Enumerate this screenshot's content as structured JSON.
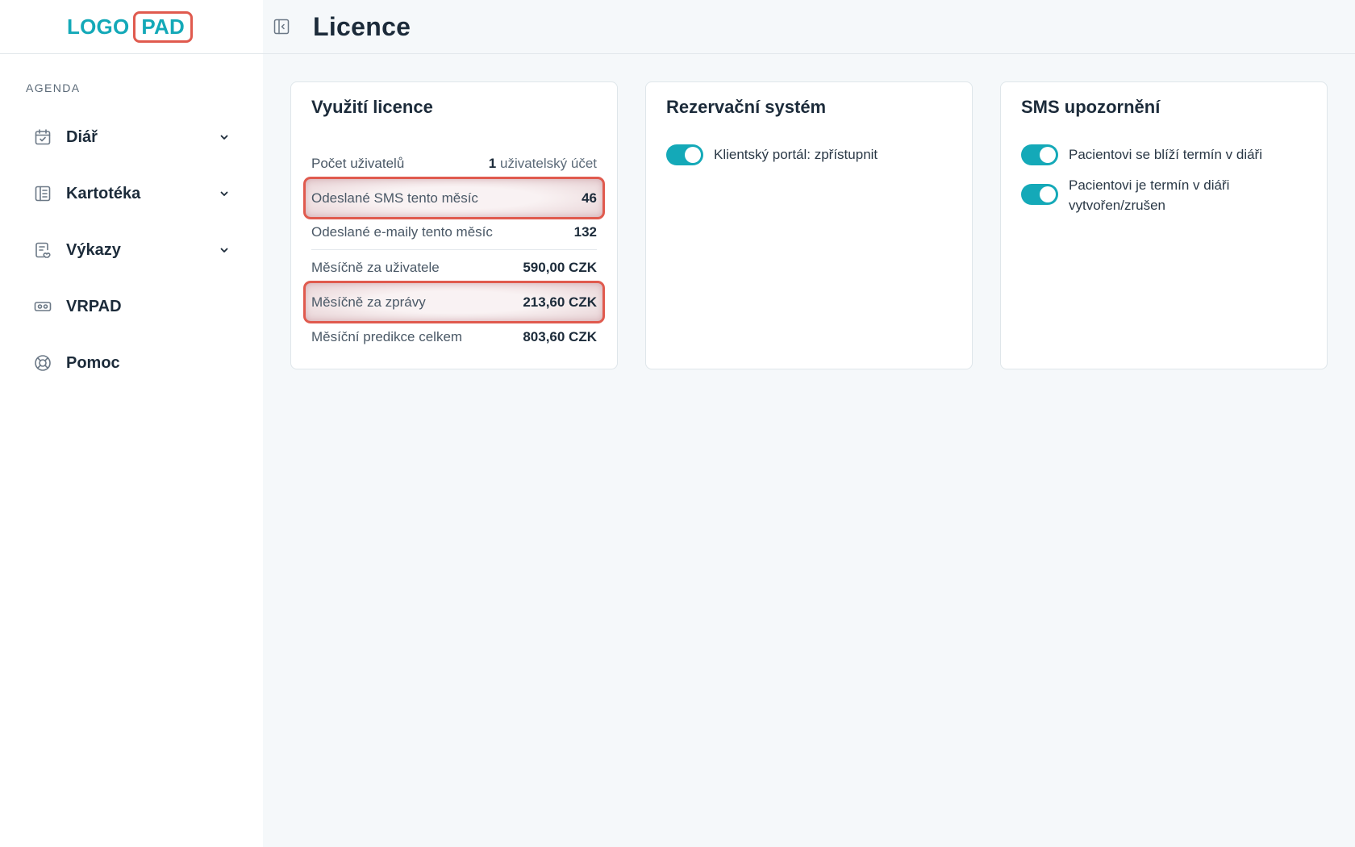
{
  "logo": {
    "left": "LOGO",
    "right": "PAD"
  },
  "sidebar": {
    "section_label": "AGENDA",
    "items": [
      {
        "label": "Diář",
        "icon": "calendar-check-icon",
        "has_chevron": true
      },
      {
        "label": "Kartotéka",
        "icon": "book-icon",
        "has_chevron": true
      },
      {
        "label": "Výkazy",
        "icon": "report-icon",
        "has_chevron": true
      },
      {
        "label": "VRPAD",
        "icon": "vr-headset-icon",
        "has_chevron": false
      },
      {
        "label": "Pomoc",
        "icon": "lifebuoy-icon",
        "has_chevron": false
      }
    ]
  },
  "header": {
    "title": "Licence"
  },
  "cards": {
    "license": {
      "title": "Využití licence",
      "rows": [
        {
          "label": "Počet uživatelů",
          "value": "1",
          "unit": "uživatelský účet"
        },
        {
          "label": "Odeslané SMS tento měsíc",
          "value": "46"
        },
        {
          "label": "Odeslané e-maily tento měsíc",
          "value": "132"
        },
        {
          "label": "Měsíčně za uživatele",
          "value": "590,00 CZK"
        },
        {
          "label": "Měsíčně za zprávy",
          "value": "213,60 CZK"
        },
        {
          "label": "Měsíční predikce celkem",
          "value": "803,60 CZK"
        }
      ]
    },
    "booking": {
      "title": "Rezervační systém",
      "toggles": [
        {
          "label": "Klientský portál: zpřístupnit",
          "on": true
        }
      ]
    },
    "sms": {
      "title": "SMS upozornění",
      "toggles": [
        {
          "label": "Pacientovi se blíží termín v diáři",
          "on": true
        },
        {
          "label_line1": "Pacientovi je termín v diáři",
          "label_line2": "vytvořen/zrušen",
          "on": true
        }
      ]
    }
  },
  "colors": {
    "accent": "#14a9b8",
    "highlight": "#e05a4e",
    "text": "#1c2b3a"
  }
}
